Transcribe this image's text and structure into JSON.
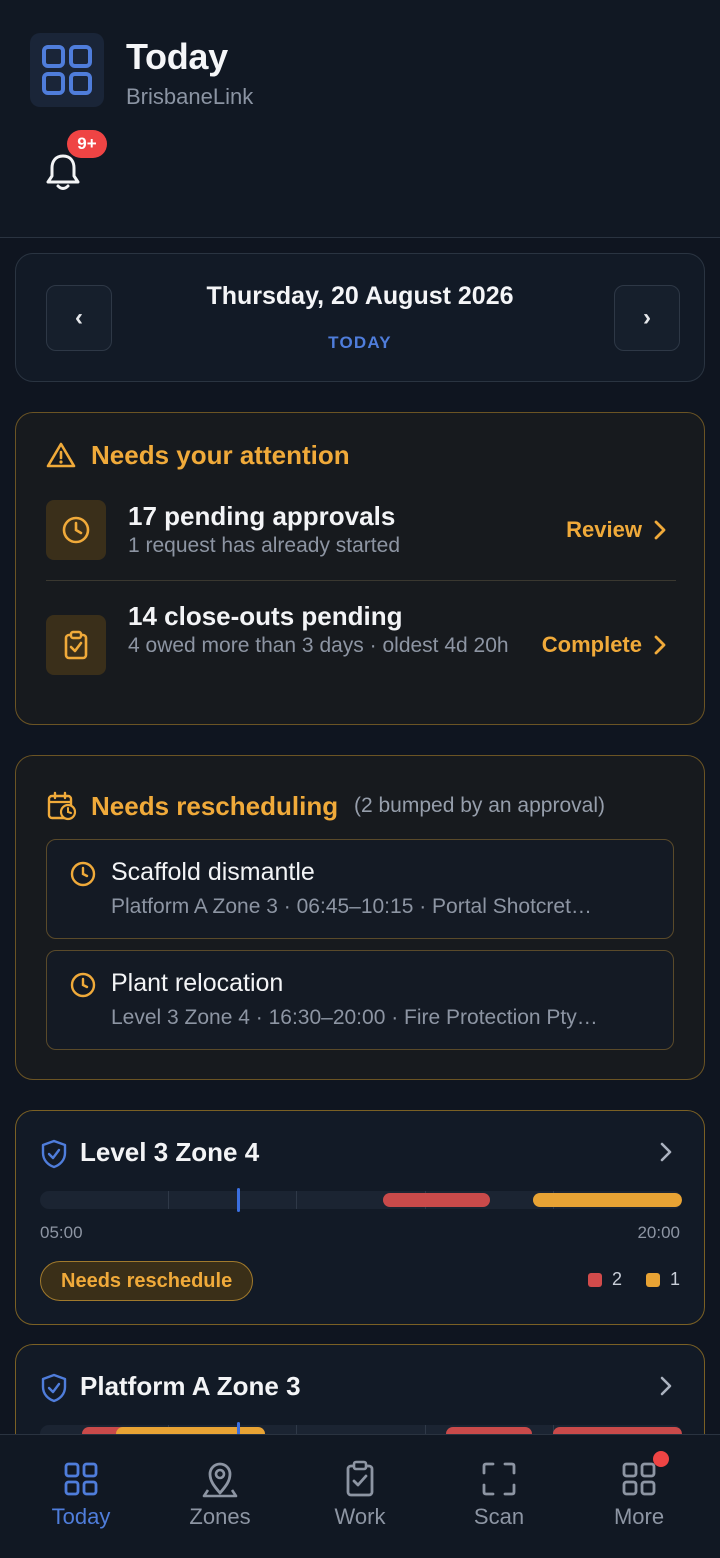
{
  "header": {
    "title": "Today",
    "subtitle": "BrisbaneLink",
    "notification_badge": "9+"
  },
  "date_nav": {
    "prev_label": "‹",
    "next_label": "›",
    "date": "Thursday, 20 August 2026",
    "today_label": "TODAY"
  },
  "attention": {
    "title": "Needs your attention",
    "items": [
      {
        "title": "17 pending approvals",
        "sub": "1 request has already started",
        "action": "Review",
        "icon": "clock-icon"
      },
      {
        "title": "14 close-outs pending",
        "sub": "4 owed more than 3 days · oldest 4d 20h",
        "action": "Complete",
        "icon": "clipboard-check-icon"
      }
    ]
  },
  "rescheduling": {
    "title": "Needs rescheduling",
    "note": "(2 bumped by an approval)",
    "items": [
      {
        "title": "Scaffold dismantle",
        "sub": "Platform A Zone 3 · 06:45–10:15 · Portal Shotcret…"
      },
      {
        "title": "Plant relocation",
        "sub": "Level 3 Zone 4 · 16:30–20:00 · Fire Protection Pty…"
      }
    ]
  },
  "zones": [
    {
      "name": "Level 3 Zone 4",
      "start_time": "05:00",
      "end_time": "20:00",
      "status": "Needs reschedule",
      "legend": [
        {
          "color": "#d14b4b",
          "count": "2"
        },
        {
          "color": "#e8a334",
          "count": "1"
        }
      ]
    },
    {
      "name": "Platform A Zone 3"
    }
  ],
  "tabs": [
    {
      "label": "Today",
      "icon": "grid-icon",
      "active": true
    },
    {
      "label": "Zones",
      "icon": "map-pin-icon"
    },
    {
      "label": "Work",
      "icon": "clipboard-check-icon"
    },
    {
      "label": "Scan",
      "icon": "scan-icon"
    },
    {
      "label": "More",
      "icon": "apps-icon"
    }
  ],
  "colors": {
    "accent": "#4f7ddb",
    "warning": "#f0aa3a",
    "danger": "#d14b4b",
    "background": "#0f1520"
  }
}
